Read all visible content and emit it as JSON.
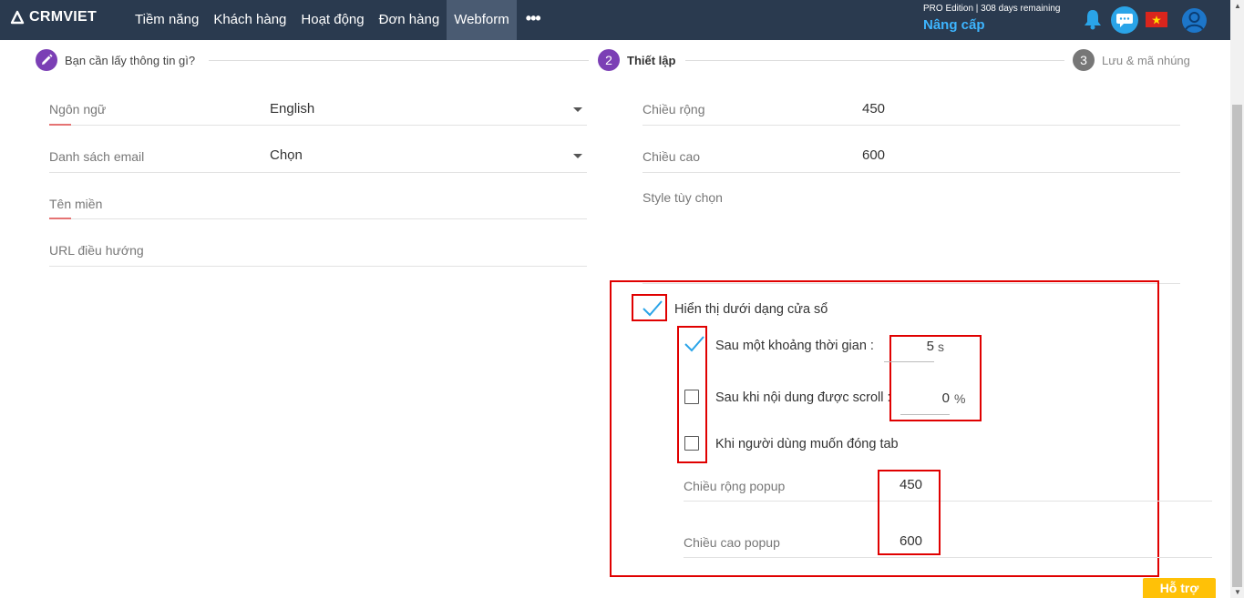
{
  "header": {
    "logo_text": "CRMVIET",
    "nav": [
      "Tiềm năng",
      "Khách hàng",
      "Hoạt động",
      "Đơn hàng",
      "Webform"
    ],
    "more": "•••",
    "edition": "PRO Edition | 308 days remaining",
    "upgrade": "Nâng cấp"
  },
  "steps": [
    {
      "number": "",
      "label": "Bạn cần lấy thông tin gì?"
    },
    {
      "number": "2",
      "label": "Thiết lập"
    },
    {
      "number": "3",
      "label": "Lưu & mã nhúng"
    }
  ],
  "left_form": {
    "language_label": "Ngôn ngữ",
    "language_value": "English",
    "email_list_label": "Danh sách email",
    "email_list_value": "Chọn",
    "domain_label": "Tên miền",
    "redirect_label": "URL điều hướng"
  },
  "right_form": {
    "width_label": "Chiều rộng",
    "width_value": "450",
    "height_label": "Chiều cao",
    "height_value": "600",
    "style_label": "Style tùy chọn"
  },
  "popup": {
    "show_as_window_label": "Hiển thị dưới dạng cửa sổ",
    "show_as_window_checked": true,
    "after_time_label": "Sau một khoảng thời gian :",
    "after_time_checked": true,
    "after_time_value": "5",
    "after_time_unit": "s",
    "after_scroll_label": "Sau khi nội dung được scroll :",
    "after_scroll_checked": false,
    "after_scroll_value": "0",
    "after_scroll_unit": "%",
    "on_close_tab_label": "Khi người dùng muốn đóng tab",
    "on_close_tab_checked": false,
    "popup_width_label": "Chiều rộng popup",
    "popup_width_value": "450",
    "popup_height_label": "Chiều cao popup",
    "popup_height_value": "600"
  },
  "support_label": "Hỗ trợ",
  "colors": {
    "topbar": "#2a3a4f",
    "step_active": "#7b3fb5",
    "step_inactive": "#777777",
    "highlight": "#e00000",
    "check": "#2aa4e8",
    "support": "#ffc107"
  }
}
